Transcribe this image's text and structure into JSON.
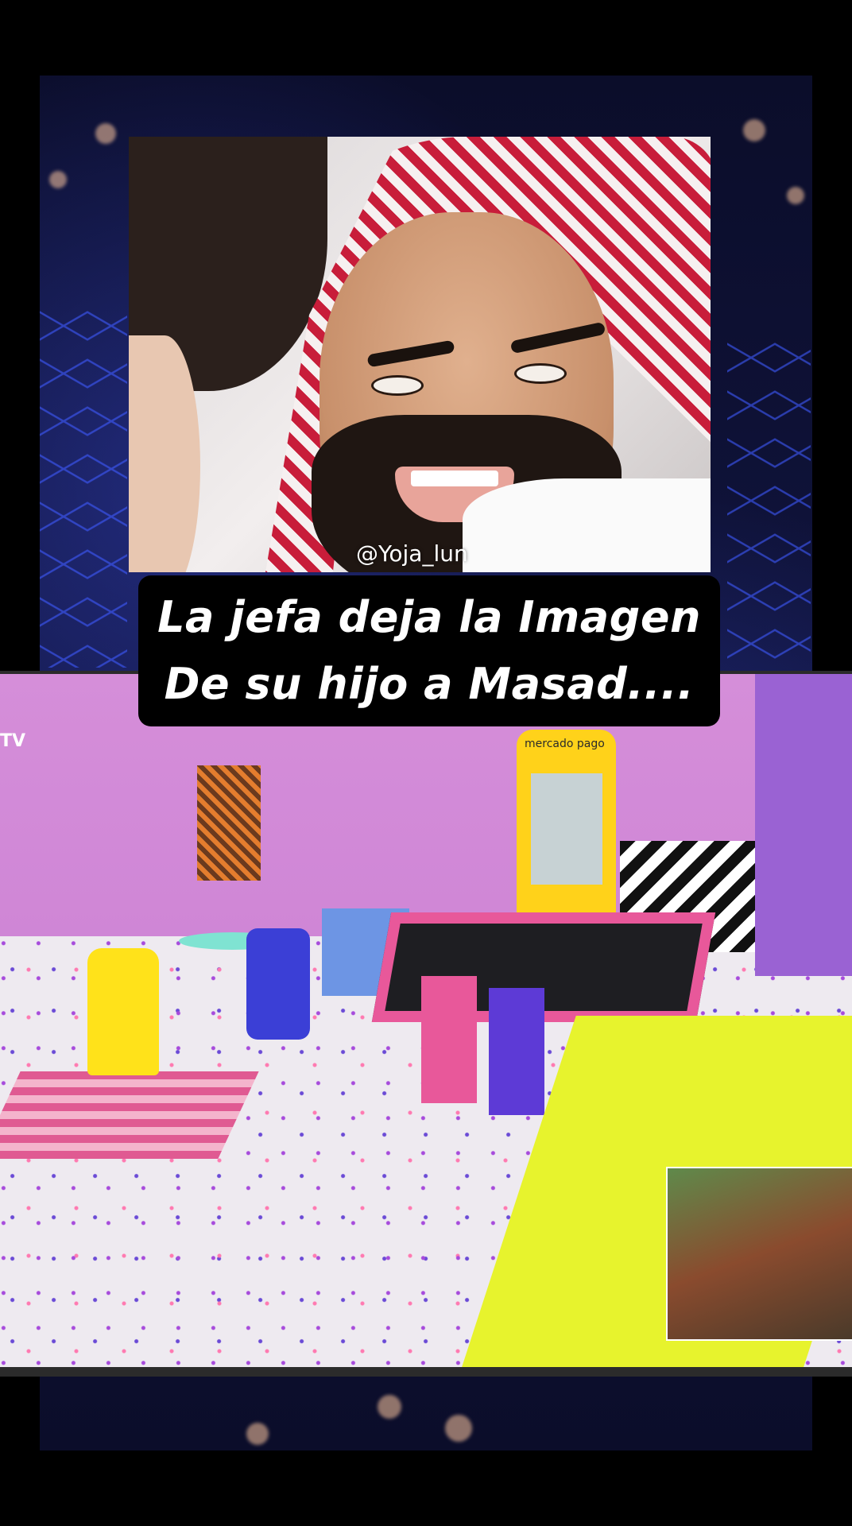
{
  "overlay": {
    "watermark": "@Yoja_lun",
    "caption_line1": "La jefa deja la Imagen",
    "caption_line2": "De su hijo a Masad....",
    "tv_label": "TV",
    "atm_brand": "mercado pago"
  },
  "colors": {
    "background": "#000000",
    "caption_bg": "#000000",
    "caption_text": "#ffffff",
    "room_wall": "#cf86d6",
    "accent_pink": "#e8589a"
  }
}
